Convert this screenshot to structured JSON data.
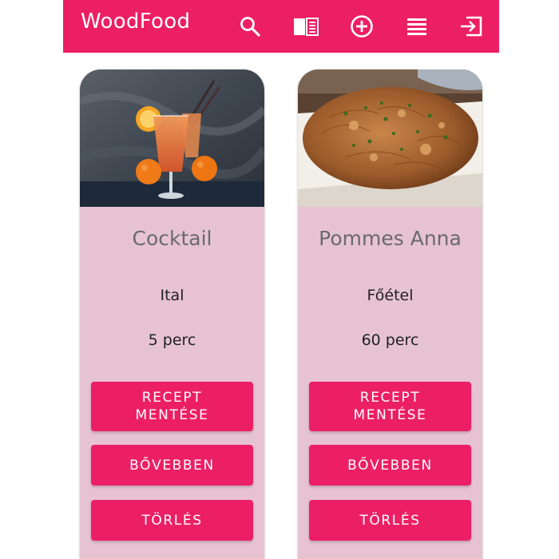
{
  "navbar": {
    "brand": "WoodFood",
    "icons": [
      "search-icon",
      "book-icon",
      "add-circle-icon",
      "list-icon",
      "logout-icon"
    ],
    "color": "#ec1f65"
  },
  "recipes": [
    {
      "title": "Cocktail",
      "category": "Ital",
      "time": "5 perc",
      "save_label": "RECEPT MENTÉSE",
      "more_label": "BŐVEBBEN",
      "delete_label": "TÖRLÉS"
    },
    {
      "title": "Pommes Anna",
      "category": "Főétel",
      "time": "60 perc",
      "save_label": "RECEPT MENTÉSE",
      "more_label": "BŐVEBBEN",
      "delete_label": "TÖRLÉS"
    }
  ],
  "colors": {
    "accent": "#ec1f65",
    "card_bg": "#e7c3d1"
  }
}
